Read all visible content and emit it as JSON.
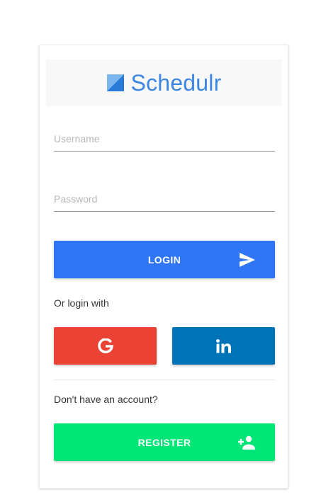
{
  "brand": {
    "name": "Schedulr",
    "logo_icon": "square-diagonal-logo-icon"
  },
  "form": {
    "username_placeholder": "Username",
    "password_placeholder": "Password"
  },
  "login_button": {
    "label": "LOGIN",
    "icon": "send-icon"
  },
  "social": {
    "prompt": "Or login with",
    "google_icon": "google-g-icon",
    "linkedin_icon": "linkedin-in-icon"
  },
  "register": {
    "prompt": "Don't have an account?",
    "button_label": "REGISTER",
    "icon": "add-person-icon"
  },
  "colors": {
    "brand": "#3a86e0",
    "login": "#2f75f5",
    "google": "#ea4335",
    "linkedin": "#0073b6",
    "register": "#00e676"
  }
}
